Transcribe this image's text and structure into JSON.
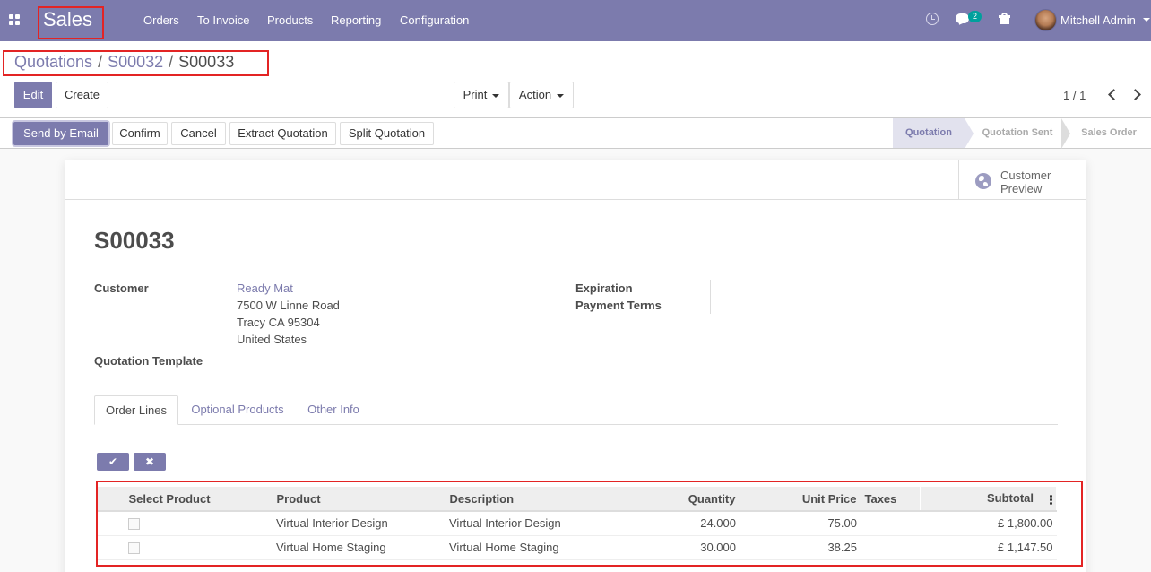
{
  "navbar": {
    "brand": "Sales",
    "menu": [
      "Orders",
      "To Invoice",
      "Products",
      "Reporting",
      "Configuration"
    ],
    "messages_badge": "2",
    "user_name": "Mitchell Admin",
    "accent_color": "#7c7bad"
  },
  "breadcrumb": {
    "parent": "Quotations",
    "middle": "S00032",
    "current": "S00033",
    "separator": "/"
  },
  "buttons": {
    "edit": "Edit",
    "create": "Create",
    "print": "Print",
    "action": "Action"
  },
  "pager": {
    "value": "1 / 1"
  },
  "header_buttons": {
    "send_email": "Send by Email",
    "confirm": "Confirm",
    "cancel": "Cancel",
    "extract": "Extract Quotation",
    "split": "Split Quotation"
  },
  "stages": {
    "quotation": "Quotation",
    "sent": "Quotation Sent",
    "order": "Sales Order",
    "active": "Quotation"
  },
  "preview": {
    "line1": "Customer",
    "line2": "Preview"
  },
  "form": {
    "title": "S00033",
    "customer_label": "Customer",
    "customer_name": "Ready Mat",
    "address_line1": "7500 W Linne Road",
    "address_line2": "Tracy CA 95304",
    "address_line3": "United States",
    "template_label": "Quotation Template",
    "expiration_label": "Expiration",
    "payment_terms_label": "Payment Terms"
  },
  "tabs": {
    "order_lines": "Order Lines",
    "optional": "Optional Products",
    "other": "Other Info"
  },
  "mini_buttons": {
    "save": "✔",
    "discard": "✖"
  },
  "table": {
    "headers": {
      "select": "Select Product",
      "product": "Product",
      "description": "Description",
      "quantity": "Quantity",
      "unit_price": "Unit Price",
      "taxes": "Taxes",
      "subtotal": "Subtotal"
    },
    "rows": [
      {
        "product": "Virtual Interior Design",
        "description": "Virtual Interior Design",
        "quantity": "24.000",
        "unit_price": "75.00",
        "taxes": "",
        "subtotal": "£ 1,800.00"
      },
      {
        "product": "Virtual Home Staging",
        "description": "Virtual Home Staging",
        "quantity": "30.000",
        "unit_price": "38.25",
        "taxes": "",
        "subtotal": "£ 1,147.50"
      }
    ]
  }
}
